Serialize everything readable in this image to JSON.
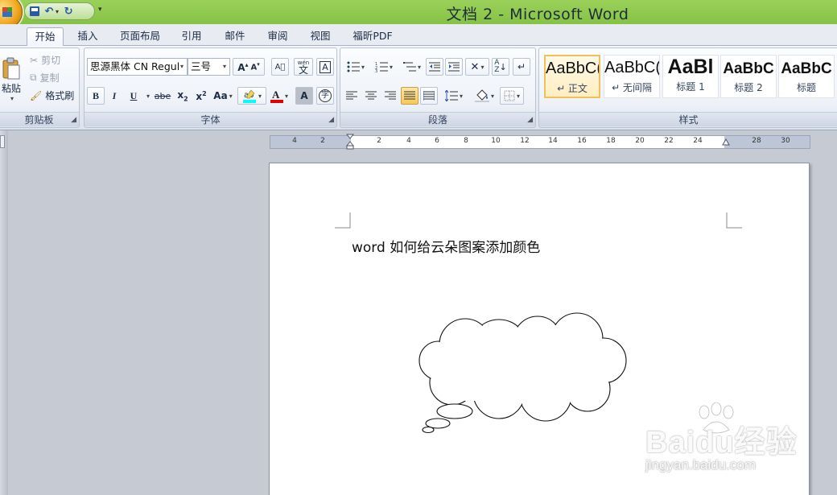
{
  "window": {
    "title": "文档 2 - Microsoft Word"
  },
  "quick_access": {
    "items": [
      "save-icon",
      "undo-icon",
      "redo-icon",
      "customize-icon"
    ]
  },
  "tabs": [
    {
      "label": "开始",
      "active": true
    },
    {
      "label": "插入",
      "active": false
    },
    {
      "label": "页面布局",
      "active": false
    },
    {
      "label": "引用",
      "active": false
    },
    {
      "label": "邮件",
      "active": false
    },
    {
      "label": "审阅",
      "active": false
    },
    {
      "label": "视图",
      "active": false
    },
    {
      "label": "福昕PDF",
      "active": false
    }
  ],
  "clipboard": {
    "paste_label": "粘贴",
    "cut_label": "剪切",
    "copy_label": "复制",
    "format_painter_label": "格式刷",
    "group_label": "剪贴板"
  },
  "font": {
    "font_name": "思源黑体 CN Regul",
    "font_size": "三号",
    "group_label": "字体",
    "bold": "B",
    "italic": "I",
    "underline": "U",
    "strike": "abe",
    "change_case": "Aa",
    "char_border": "A",
    "phonetic": "wén",
    "phonetic_char": "文",
    "enclose_char": "字",
    "highlight_color": "#00ffff",
    "font_color": "#e00000"
  },
  "paragraph": {
    "group_label": "段落"
  },
  "styles": {
    "group_label": "样式",
    "items": [
      {
        "sample": "AaBbC(",
        "name": "↵ 正文",
        "selected": true
      },
      {
        "sample": "AaBbC(",
        "name": "↵ 无间隔",
        "selected": false
      },
      {
        "sample": "AaBl",
        "name": "标题 1",
        "selected": false
      },
      {
        "sample": "AaBbC",
        "name": "标题 2",
        "selected": false
      },
      {
        "sample": "AaBbC",
        "name": "标题",
        "selected": false
      }
    ]
  },
  "ruler": {
    "labels": [
      "4",
      "2",
      "2",
      "4",
      "6",
      "8",
      "10",
      "12",
      "14",
      "16",
      "18",
      "20",
      "22",
      "24",
      "28",
      "30"
    ]
  },
  "document": {
    "body_text": "word 如何给云朵图案添加颜色"
  },
  "watermark": {
    "brand": "Baidu经验",
    "url": "jingyan.baidu.com"
  }
}
